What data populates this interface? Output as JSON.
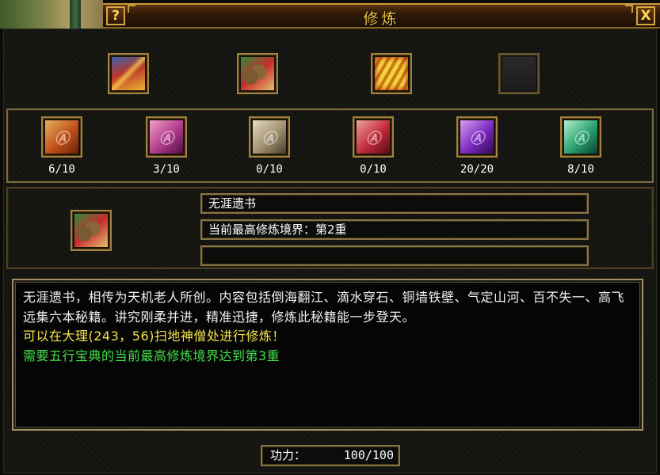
{
  "window": {
    "title": "修炼",
    "help_label": "?",
    "close_label": "X"
  },
  "top_books": [
    {
      "name": "book-red-icon"
    },
    {
      "name": "scroll-bundle-green-icon"
    },
    {
      "name": "bamboo-slips-gold-icon"
    },
    {
      "name": "empty-slot"
    }
  ],
  "skill_scrolls": [
    {
      "icon": "scroll-orange-icon",
      "count": "6/10"
    },
    {
      "icon": "scroll-pink-icon",
      "count": "3/10"
    },
    {
      "icon": "scroll-silver-icon",
      "count": "0/10"
    },
    {
      "icon": "scroll-red-icon",
      "count": "0/10"
    },
    {
      "icon": "scroll-purple-icon",
      "count": "20/20"
    },
    {
      "icon": "scroll-teal-icon",
      "count": "8/10"
    }
  ],
  "selected": {
    "name": "无涯遗书",
    "realm": "当前最高修炼境界：第2重",
    "extra": ""
  },
  "description": {
    "text": "无涯遗书，相传为天机老人所创。内容包括倒海翻江、滴水穿石、铜墙铁壁、气定山河、百不失一、高飞远集六本秘籍。讲究刚柔并进，精准迅捷，修炼此秘籍能一步登天。",
    "location": "可以在大理(243，56)扫地神僧处进行修炼！",
    "requirement": "需要五行宝典的当前最高修炼境界达到第3重"
  },
  "power": {
    "label": "功力：",
    "value": "100/100"
  },
  "colors": {
    "title_gold": "#f2c640",
    "location_yellow": "#f4e24a",
    "requirement_green": "#44e04a"
  }
}
